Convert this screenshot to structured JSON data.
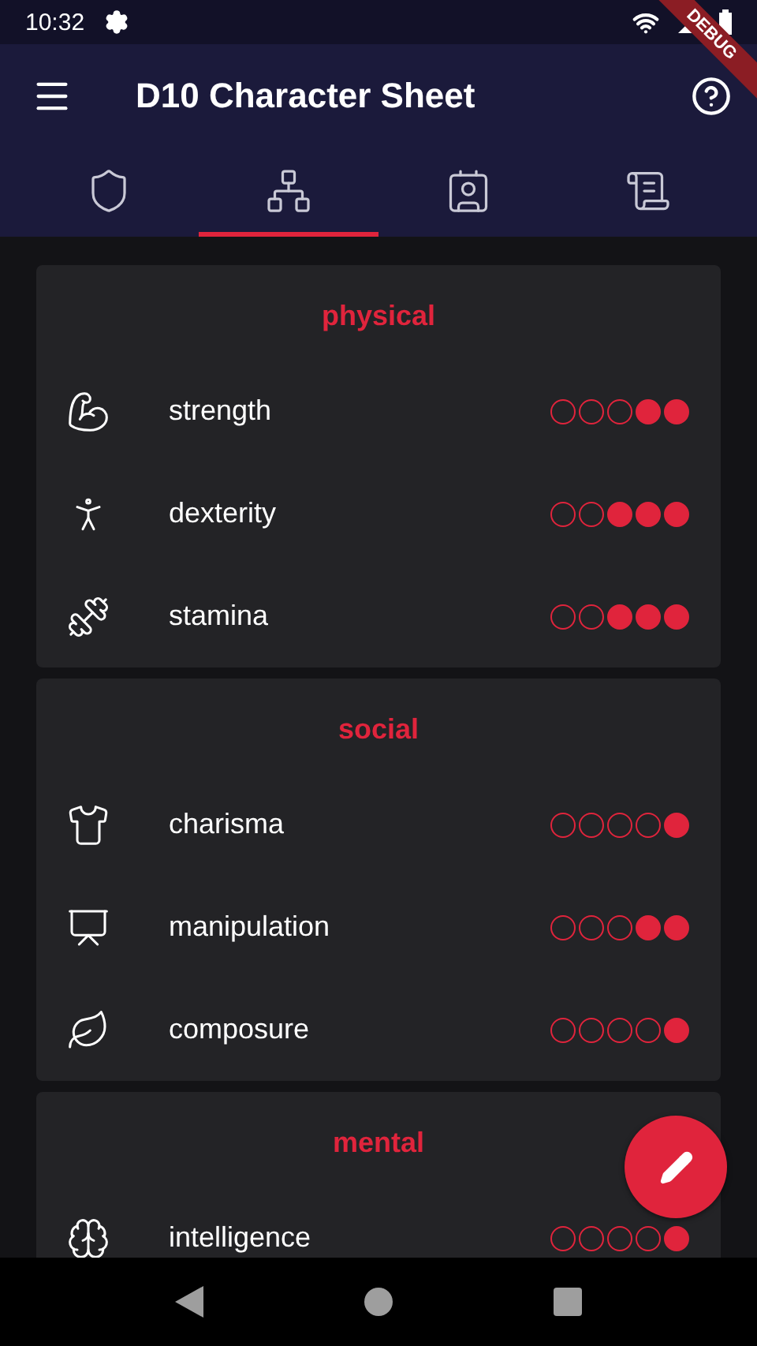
{
  "status_bar": {
    "time": "10:32"
  },
  "debug_banner": "DEBUG",
  "app_bar": {
    "title": "D10 Character Sheet"
  },
  "tabs": [
    {
      "selected": false
    },
    {
      "selected": true
    },
    {
      "selected": false
    },
    {
      "selected": false
    }
  ],
  "sections": [
    {
      "title": "physical",
      "stats": [
        {
          "name": "strength",
          "stars": 2
        },
        {
          "name": "dexterity",
          "stars": 3
        },
        {
          "name": "stamina",
          "stars": 3
        }
      ]
    },
    {
      "title": "social",
      "stats": [
        {
          "name": "charisma",
          "stars": 1
        },
        {
          "name": "manipulation",
          "stars": 2
        },
        {
          "name": "composure",
          "stars": 1
        }
      ]
    },
    {
      "title": "mental",
      "stats": [
        {
          "name": "intelligence",
          "stars": 1
        }
      ]
    }
  ]
}
